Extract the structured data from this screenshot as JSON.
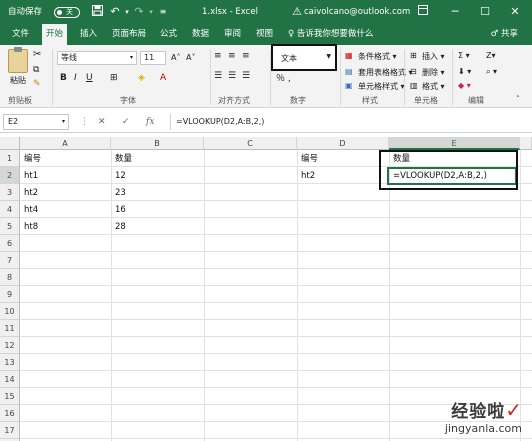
{
  "titlebar": {
    "autosave_label": "自动保存",
    "autosave_state": "关",
    "save_icon": "save-icon",
    "undo_icon": "undo-icon",
    "redo_icon": "redo-icon",
    "customize_icon": "customize-qat-icon",
    "title": "1.xlsx  -  Excel",
    "warning_icon": "warning-icon",
    "account": "caivolcano@outlook.com",
    "ribbon_display_icon": "ribbon-display-icon",
    "minimize": "─",
    "maximize": "☐",
    "close": "✕"
  },
  "tabs": [
    {
      "label": "文件"
    },
    {
      "label": "开始"
    },
    {
      "label": "插入"
    },
    {
      "label": "页面布局"
    },
    {
      "label": "公式"
    },
    {
      "label": "数据"
    },
    {
      "label": "审阅"
    },
    {
      "label": "视图"
    }
  ],
  "tell_me": "♀ 告诉我你想要做什么",
  "share": "♂ 共享",
  "ribbon": {
    "clipboard": {
      "paste": "粘贴",
      "group": "剪贴板"
    },
    "font": {
      "name": "等线",
      "size": "11",
      "grow": "A˄",
      "shrink": "A˅",
      "bold": "B",
      "italic": "I",
      "underline": "U",
      "group": "字体"
    },
    "alignment": {
      "group": "对齐方式"
    },
    "number": {
      "format": "文本",
      "group": "数字"
    },
    "styles": {
      "conditional": "条件格式 ▾",
      "table": "套用表格格式 ▾",
      "cell": "单元格样式 ▾",
      "group": "样式"
    },
    "cells": {
      "insert": "插入 ▾",
      "delete": "删除 ▾",
      "format": "格式 ▾",
      "group": "单元格"
    },
    "editing": {
      "sum": "Σ ▾",
      "sort": "Z▾",
      "group": "编辑"
    }
  },
  "formula_bar": {
    "name_box": "E2",
    "fx": "fx",
    "formula": "=VLOOKUP(D2,A:B,2,)"
  },
  "columns": [
    "A",
    "B",
    "C",
    "D",
    "E"
  ],
  "rows": [
    "1",
    "2",
    "3",
    "4",
    "5",
    "6",
    "7",
    "8",
    "9",
    "10",
    "11",
    "12",
    "13",
    "14",
    "15",
    "16",
    "17",
    "18"
  ],
  "cells": {
    "A1": "编号",
    "B1": "数量",
    "A2": "ht1",
    "B2": "12",
    "A3": "ht2",
    "B3": "23",
    "A4": "ht4",
    "B4": "16",
    "A5": "ht8",
    "B5": "28",
    "D1": "编号",
    "E1": "数量",
    "D2": "ht2",
    "E2": "=VLOOKUP(D2,A:B,2,)"
  },
  "watermark": {
    "text": "经验啦",
    "check": "✓",
    "url": "jingyanla.com"
  },
  "colors": {
    "excel_green": "#217346",
    "ribbon_bg": "#f3f3f3"
  }
}
